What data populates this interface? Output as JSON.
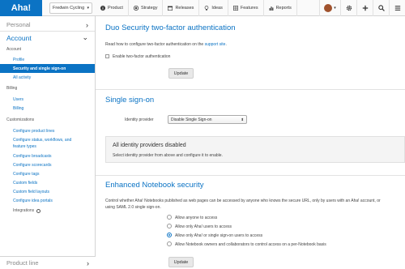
{
  "topnav": {
    "logo": "Aha!",
    "workspace": "Fredwin Cycling",
    "tabs": [
      {
        "label": "Product",
        "icon": "info-icon"
      },
      {
        "label": "Strategy",
        "icon": "target-icon"
      },
      {
        "label": "Releases",
        "icon": "calendar-icon"
      },
      {
        "label": "Ideas",
        "icon": "lightbulb-icon"
      },
      {
        "label": "Features",
        "icon": "grid-icon"
      },
      {
        "label": "Reports",
        "icon": "chart-icon"
      }
    ]
  },
  "sidebar": {
    "personal": "Personal",
    "account": "Account",
    "sections": {
      "account": "Account",
      "billing": "Billing",
      "customizations": "Customizations"
    },
    "account_links": [
      "Profile",
      "Security and single sign-on",
      "All activity"
    ],
    "billing_links": [
      "Users",
      "Billing"
    ],
    "custom_links": [
      "Configure product lines",
      "Configure status, workflows, and feature types",
      "Configure broadcasts",
      "Configure scorecards",
      "Configure tags",
      "Custom fields",
      "Custom field layouts",
      "Configure idea portals"
    ],
    "integrations": "Integrations",
    "product_line": "Product line"
  },
  "duo": {
    "title": "Duo Security two-factor authentication",
    "desc_prefix": "Read how to configure two-factor authentication on the ",
    "desc_link": "support site",
    "desc_suffix": ".",
    "checkbox_label": "Enable two-factor authentication",
    "update": "Update"
  },
  "sso": {
    "title": "Single sign-on",
    "provider_label": "Identity provider",
    "provider_value": "Disable Single Sign-on",
    "panel_title": "All identity providers disabled",
    "panel_desc": "Select identity provider from above and configure it to enable."
  },
  "notebook": {
    "title": "Enhanced Notebook security",
    "desc_line1": "Control whether Aha! Notebooks published as web pages can be accessed by anyone who knows the secure URL, only by users with an Aha! account, or",
    "desc_line2": "using SAML 2.0 single sign-on.",
    "options": [
      "Allow anyone to access",
      "Allow only Aha! users to access",
      "Allow only Aha! or single sign-on users to access",
      "Allow Notebook owners and collaborators to control access on a per-Notebook basis"
    ],
    "selected_option": "Allow only Aha! or single sign-on users to access",
    "update": "Update"
  },
  "colors": {
    "accent": "#0b73c4"
  }
}
